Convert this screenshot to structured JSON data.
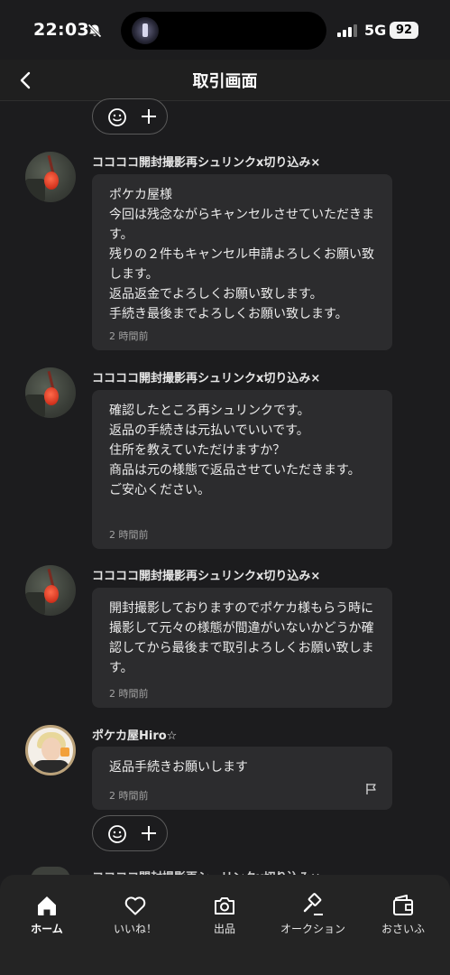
{
  "status_bar": {
    "time": "22:03",
    "network": "5G",
    "battery": "92"
  },
  "nav": {
    "title": "取引画面"
  },
  "messages": [
    {
      "sender": "ココココ開封撮影再シュリンクx切り込み×",
      "text": "ポケカ屋様\n今回は残念ながらキャンセルさせていただきます。\n残りの２件もキャンセル申請よろしくお願い致します。\n返品返金でよろしくお願い致します。\n手続き最後までよろしくお願い致します。",
      "time": "2 時間前"
    },
    {
      "sender": "ココココ開封撮影再シュリンクx切り込み×",
      "text": "確認したところ再シュリンクです。\n返品の手続きは元払いでいいです。\n住所を教えていただけますか？\n商品は元の様態で返品させていただきます。\nご安心ください。",
      "time": "2 時間前"
    },
    {
      "sender": "ココココ開封撮影再シュリンクx切り込み×",
      "text": "開封撮影しておりますのでポケカ様もらう時に撮影して元々の様態が間違がいないかどうか確認してから最後まで取引よろしくお願い致します。",
      "time": "2 時間前"
    },
    {
      "sender": "ポケカ屋Hiro☆",
      "text": "返品手続きお願いします",
      "time": "2 時間前"
    }
  ],
  "partial_message": {
    "sender": "ココココ開封撮影再シュリンクx切り込み×"
  },
  "tabs": [
    {
      "label": "ホーム",
      "icon": "home-icon",
      "active": true
    },
    {
      "label": "いいね！",
      "icon": "heart-icon",
      "active": false
    },
    {
      "label": "出品",
      "icon": "camera-icon",
      "active": false
    },
    {
      "label": "オークション",
      "icon": "gavel-icon",
      "active": false
    },
    {
      "label": "おさいふ",
      "icon": "wallet-icon",
      "active": false
    }
  ],
  "colors": {
    "background": "#1c1c1e",
    "bubble": "#2c2c2e",
    "tab_bar": "#242424",
    "text": "#ececec",
    "muted_text": "#a3a3a3"
  }
}
